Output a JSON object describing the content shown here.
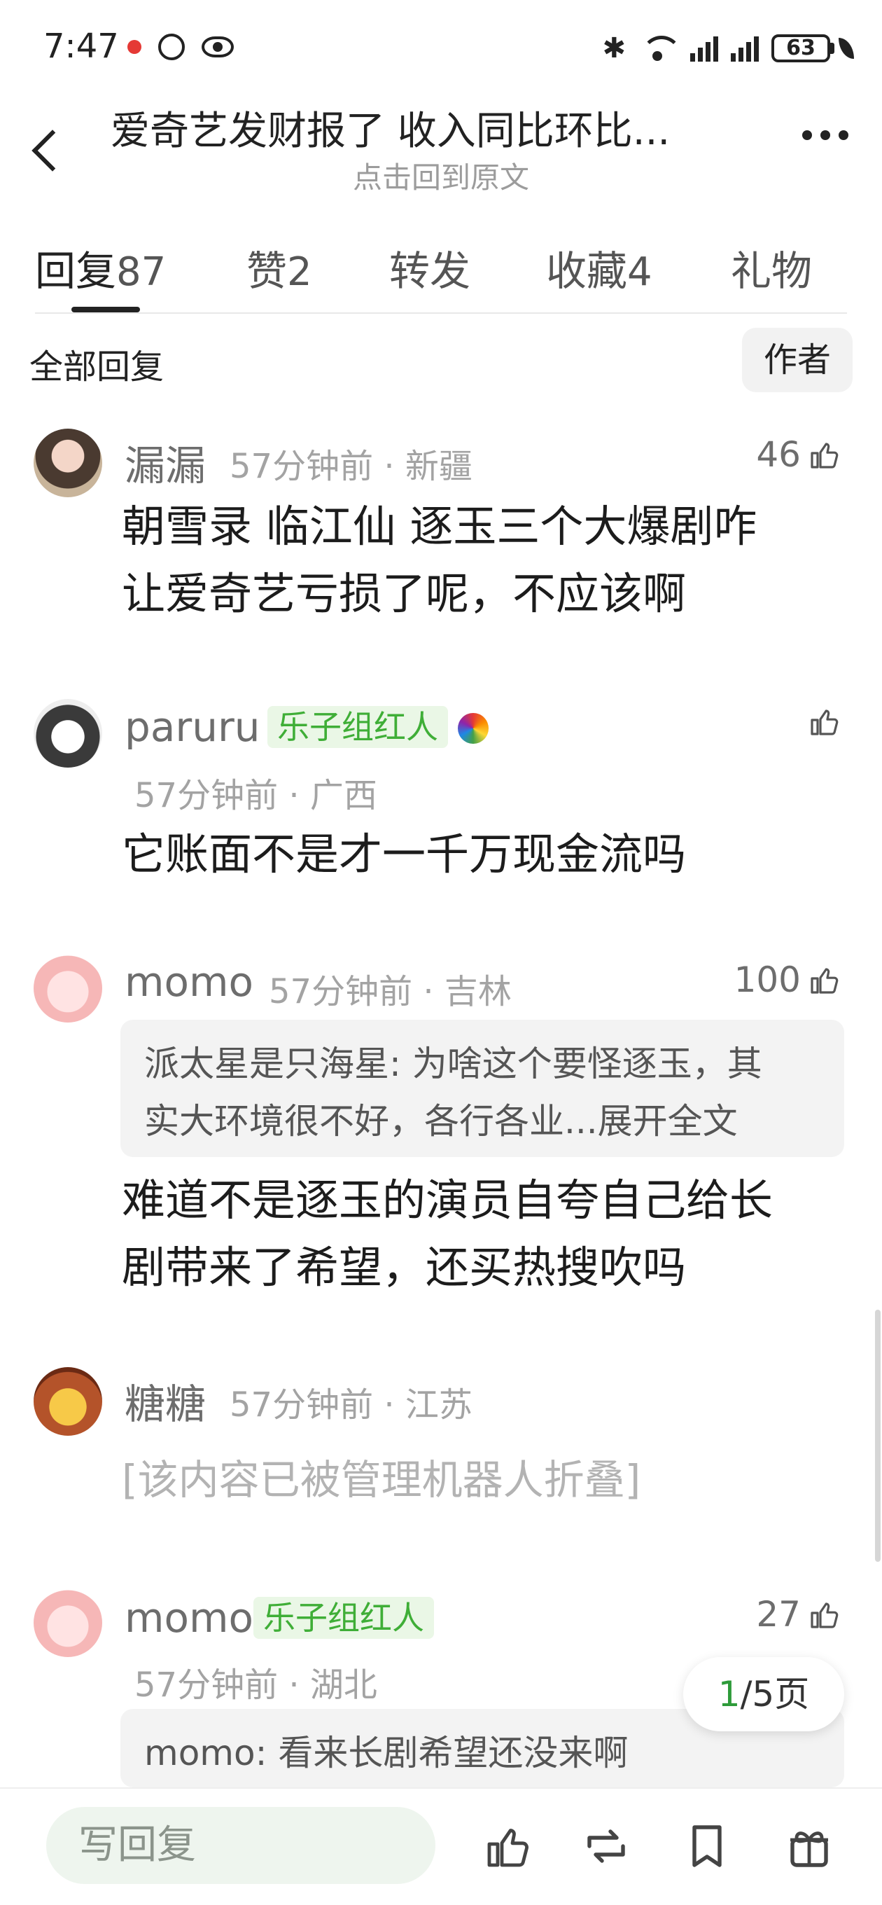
{
  "status_bar": {
    "time": "7:47",
    "battery": "63"
  },
  "header": {
    "title": "爱奇艺发财报了 收入同比环比...",
    "subtitle": "点击回到原文"
  },
  "tabs": [
    {
      "label": "回复",
      "count": "87"
    },
    {
      "label": "赞",
      "count": "2"
    },
    {
      "label": "转发",
      "count": ""
    },
    {
      "label": "收藏",
      "count": "4"
    },
    {
      "label": "礼物",
      "count": ""
    }
  ],
  "filter": {
    "all_label": "全部回复",
    "author_label": "作者"
  },
  "comments": [
    {
      "username": "漏漏",
      "time": "57分钟前",
      "location": "新疆",
      "likes": "46",
      "text_lines": [
        "朝雪录 临江仙 逐玉三个大爆剧咋",
        "让爱奇艺亏损了呢，不应该啊"
      ]
    },
    {
      "username": "paruru",
      "badge": "乐子组红人",
      "time": "57分钟前",
      "location": "广西",
      "likes": "",
      "text": "它账面不是才一千万现金流吗"
    },
    {
      "username": "momo",
      "time": "57分钟前",
      "location": "吉林",
      "likes": "100",
      "quote_author": "派太星是只海星:",
      "quote_lines": [
        "为啥这个要怪逐玉，其",
        "实大环境很不好，各行各业...展开全文"
      ],
      "text_lines": [
        "难道不是逐玉的演员自夸自己给长",
        "剧带来了希望，还买热搜吹吗"
      ]
    },
    {
      "username": "糖糖",
      "time": "57分钟前",
      "location": "江苏",
      "folded_text": "[该内容已被管理机器人折叠]"
    },
    {
      "username": "momo",
      "badge": "乐子组红人",
      "time": "57分钟前",
      "location": "湖北",
      "likes": "27",
      "quote_text": "momo: 看来长剧希望还没来啊"
    }
  ],
  "pagination": {
    "current": "1",
    "total_text": "/5页"
  },
  "bottom_bar": {
    "reply_placeholder": "写回复"
  },
  "colors": {
    "badge_green": "#3fae37",
    "badge_bg": "#eaf7e6",
    "page_current": "#2e9b3a"
  }
}
